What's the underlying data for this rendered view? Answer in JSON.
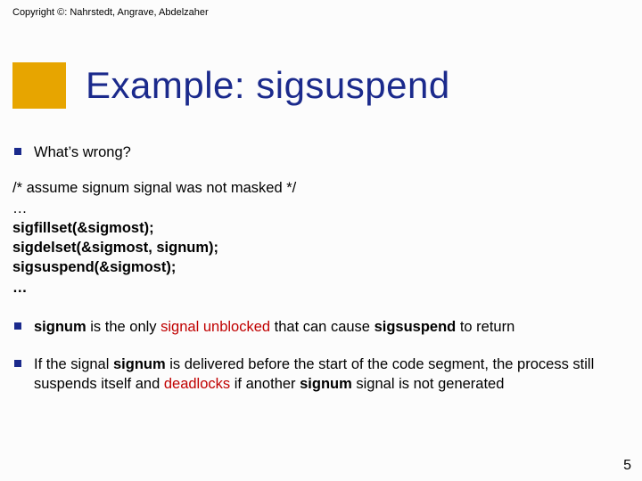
{
  "copyright": "Copyright ©: Nahrstedt, Angrave, Abdelzaher",
  "title": "Example: sigsuspend",
  "bullets": {
    "b1": "What’s wrong?"
  },
  "code": {
    "l1": "/* assume signum signal was not masked */",
    "l2": "…",
    "l3": "sigfillset(&sigmost);",
    "l4": "sigdelset(&sigmost, signum);",
    "l5": "sigsuspend(&sigmost);",
    "l6": "…"
  },
  "b2": {
    "p1": "signum",
    "p2": " is the only ",
    "p3": "signal unblocked",
    "p4": " that can cause ",
    "p5": "sigsuspend",
    "p6": " to return"
  },
  "b3": {
    "p1": "If the signal ",
    "p2": "signum",
    "p3": " is delivered before the start of the code segment, the process still suspends itself and ",
    "p4": "deadlocks",
    "p5": " if another ",
    "p6": "signum",
    "p7": " signal is not generated"
  },
  "pagenum": "5"
}
